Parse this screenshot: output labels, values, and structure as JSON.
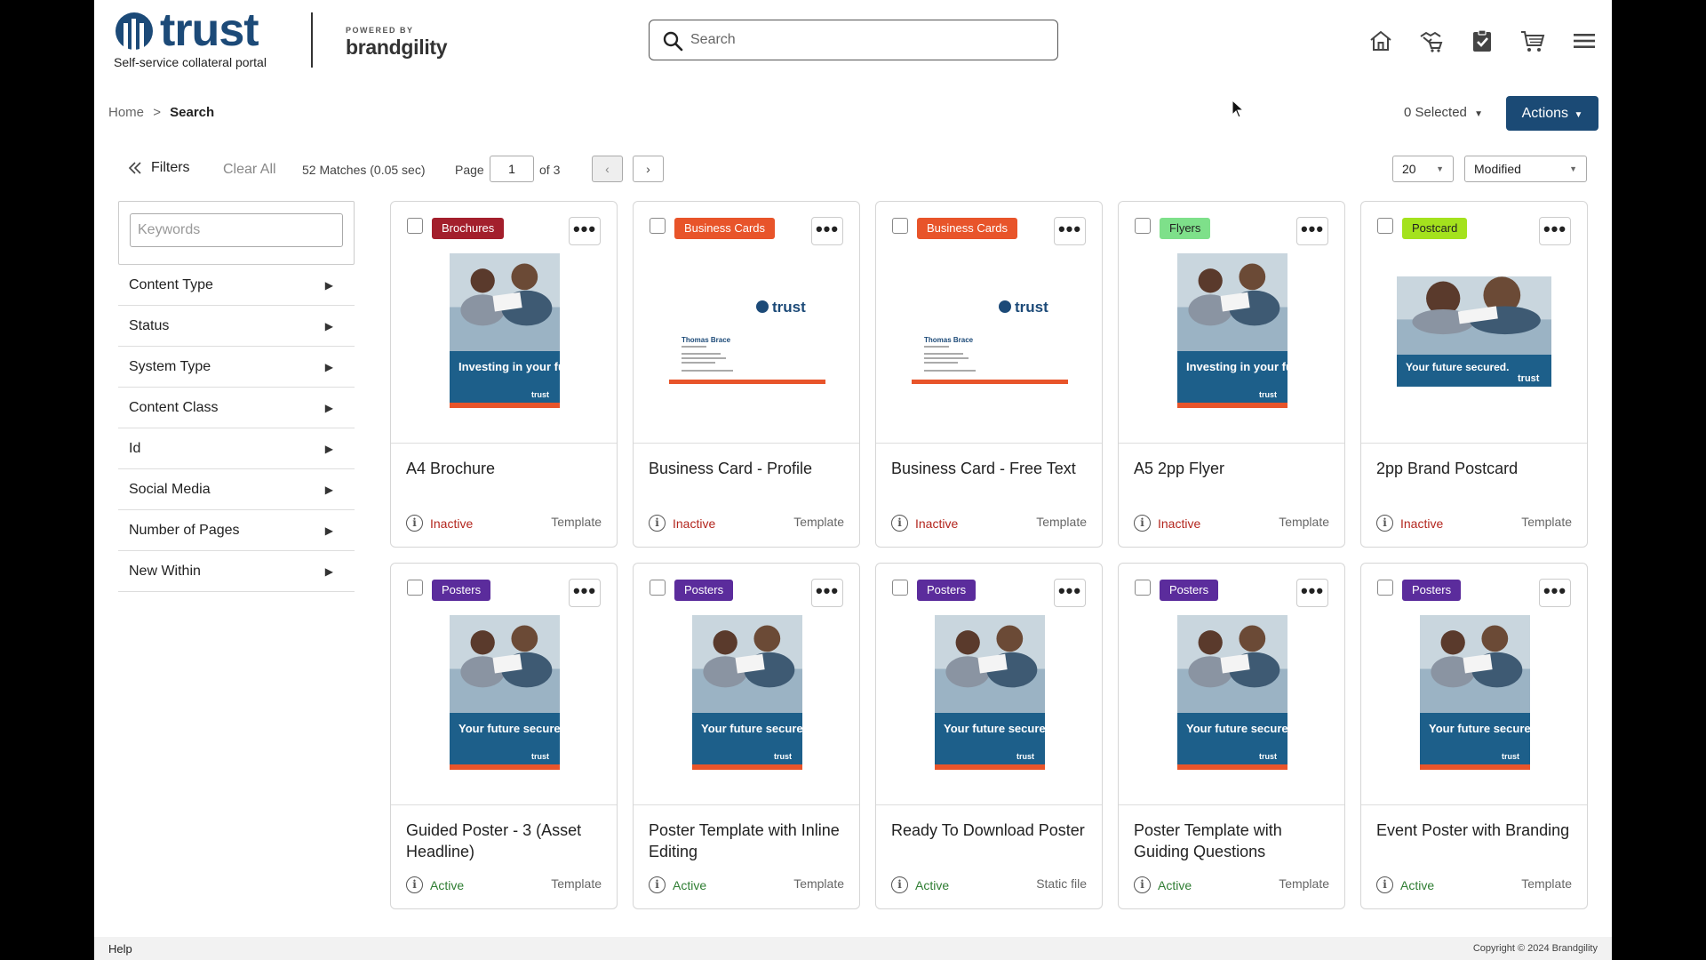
{
  "header": {
    "logo_word": "trust",
    "tagline": "Self-service collateral portal",
    "powered_by": "POWERED BY",
    "powered_brand": "brandgility",
    "search_placeholder": "Search"
  },
  "breadcrumb": {
    "home": "Home",
    "separator": ">",
    "current": "Search"
  },
  "toolbar": {
    "selected": "0 Selected",
    "actions": "Actions",
    "filters": "Filters",
    "clear_all": "Clear All",
    "matches": "52 Matches (0.05 sec)",
    "page_label": "Page",
    "page_value": "1",
    "page_of": "of 3",
    "per_page": "20",
    "sort": "Modified"
  },
  "sidebar": {
    "keywords_placeholder": "Keywords",
    "facets": [
      "Content Type",
      "Status",
      "System Type",
      "Content Class",
      "Id",
      "Social Media",
      "Number of Pages",
      "New Within"
    ]
  },
  "badge_colors": {
    "Brochures": "#a31f2c",
    "Business Cards": "#e8542a",
    "Flyers": "#7ee08a",
    "Postcard": "#a4e21d",
    "Posters": "#5b2c9c"
  },
  "cards": [
    {
      "badge": "Brochures",
      "title": "A4 Brochure",
      "status": "Inactive",
      "type": "Template",
      "thumb": "portrait",
      "caption": "Investing in your future."
    },
    {
      "badge": "Business Cards",
      "title": "Business Card - Profile",
      "status": "Inactive",
      "type": "Template",
      "thumb": "bizcard",
      "caption": "Thomas Brace"
    },
    {
      "badge": "Business Cards",
      "title": "Business Card - Free Text",
      "status": "Inactive",
      "type": "Template",
      "thumb": "bizcard",
      "caption": "Thomas Brace"
    },
    {
      "badge": "Flyers",
      "title": "A5 2pp Flyer",
      "status": "Inactive",
      "type": "Template",
      "thumb": "portrait",
      "caption": "Investing in your future"
    },
    {
      "badge": "Postcard",
      "title": "2pp Brand Postcard",
      "status": "Inactive",
      "type": "Template",
      "thumb": "landscape",
      "caption": "Your future secured."
    },
    {
      "badge": "Posters",
      "title": "Guided Poster - 3 (Asset Headline)",
      "status": "Active",
      "type": "Template",
      "thumb": "portrait",
      "caption": "Your future secured"
    },
    {
      "badge": "Posters",
      "title": "Poster Template with Inline Editing",
      "status": "Active",
      "type": "Template",
      "thumb": "portrait",
      "caption": "Your future secured."
    },
    {
      "badge": "Posters",
      "title": "Ready To Download Poster",
      "status": "Active",
      "type": "Static file",
      "thumb": "portrait",
      "caption": "Your future secured"
    },
    {
      "badge": "Posters",
      "title": "Poster Template with Guiding Questions",
      "status": "Active",
      "type": "Template",
      "thumb": "portrait",
      "caption": "Your future secured"
    },
    {
      "badge": "Posters",
      "title": "Event Poster with Branding",
      "status": "Active",
      "type": "Template",
      "thumb": "portrait",
      "caption": "Your future secured."
    }
  ],
  "footer": {
    "help": "Help",
    "copyright": "Copyright © 2024 Brandgility"
  },
  "icons": {
    "search": "search-icon",
    "home": "home-icon",
    "handshake": "handshake-cart-icon",
    "tasks": "clipboard-check-icon",
    "cart": "cart-icon",
    "menu": "hamburger-menu-icon",
    "more": "more-dots-icon",
    "info": "info-icon"
  }
}
